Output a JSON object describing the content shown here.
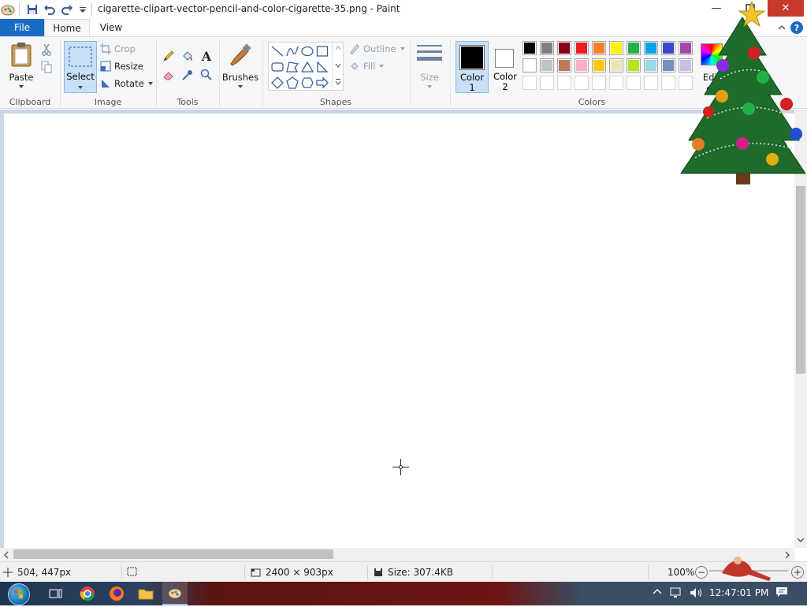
{
  "window": {
    "title": "cigarette-clipart-vector-pencil-and-color-cigarette-35.png - Paint",
    "minimize_symbol": "—",
    "close_symbol": "✕"
  },
  "tabs": {
    "file": "File",
    "home": "Home",
    "view": "View"
  },
  "ribbon": {
    "clipboard": {
      "paste": "Paste",
      "group": "Clipboard"
    },
    "image": {
      "select": "Select",
      "crop": "Crop",
      "resize": "Resize",
      "rotate": "Rotate",
      "group": "Image"
    },
    "tools": {
      "group": "Tools"
    },
    "brushes": {
      "label": "Brushes"
    },
    "shapes": {
      "outline": "Outline",
      "fill": "Fill",
      "group": "Shapes"
    },
    "size": {
      "label": "Size"
    },
    "colors": {
      "color1_label": "Color",
      "color1_num": "1",
      "color2_label": "Color",
      "color2_num": "2",
      "edit_colors": "Edit",
      "edit_colors_2": "co",
      "group": "Colors",
      "color1_value": "#000000",
      "color2_value": "#ffffff",
      "palette_row1": [
        "#000000",
        "#7f7f7f",
        "#880015",
        "#ed1c24",
        "#ff7f27",
        "#fff200",
        "#22b14c",
        "#00a2e8",
        "#3f48cc",
        "#a349a4"
      ],
      "palette_row2": [
        "#ffffff",
        "#c3c3c3",
        "#b97a57",
        "#ffaec9",
        "#ffc90e",
        "#efe4b0",
        "#b5e61d",
        "#99d9ea",
        "#7092be",
        "#c8bfe7"
      ]
    }
  },
  "statusbar": {
    "cursor_pos": "504, 447px",
    "canvas_size": "2400 × 903px",
    "file_size": "Size: 307.4KB",
    "zoom": "100%"
  },
  "taskbar": {
    "clock": "12:47:01 PM"
  },
  "help_symbol": "?"
}
